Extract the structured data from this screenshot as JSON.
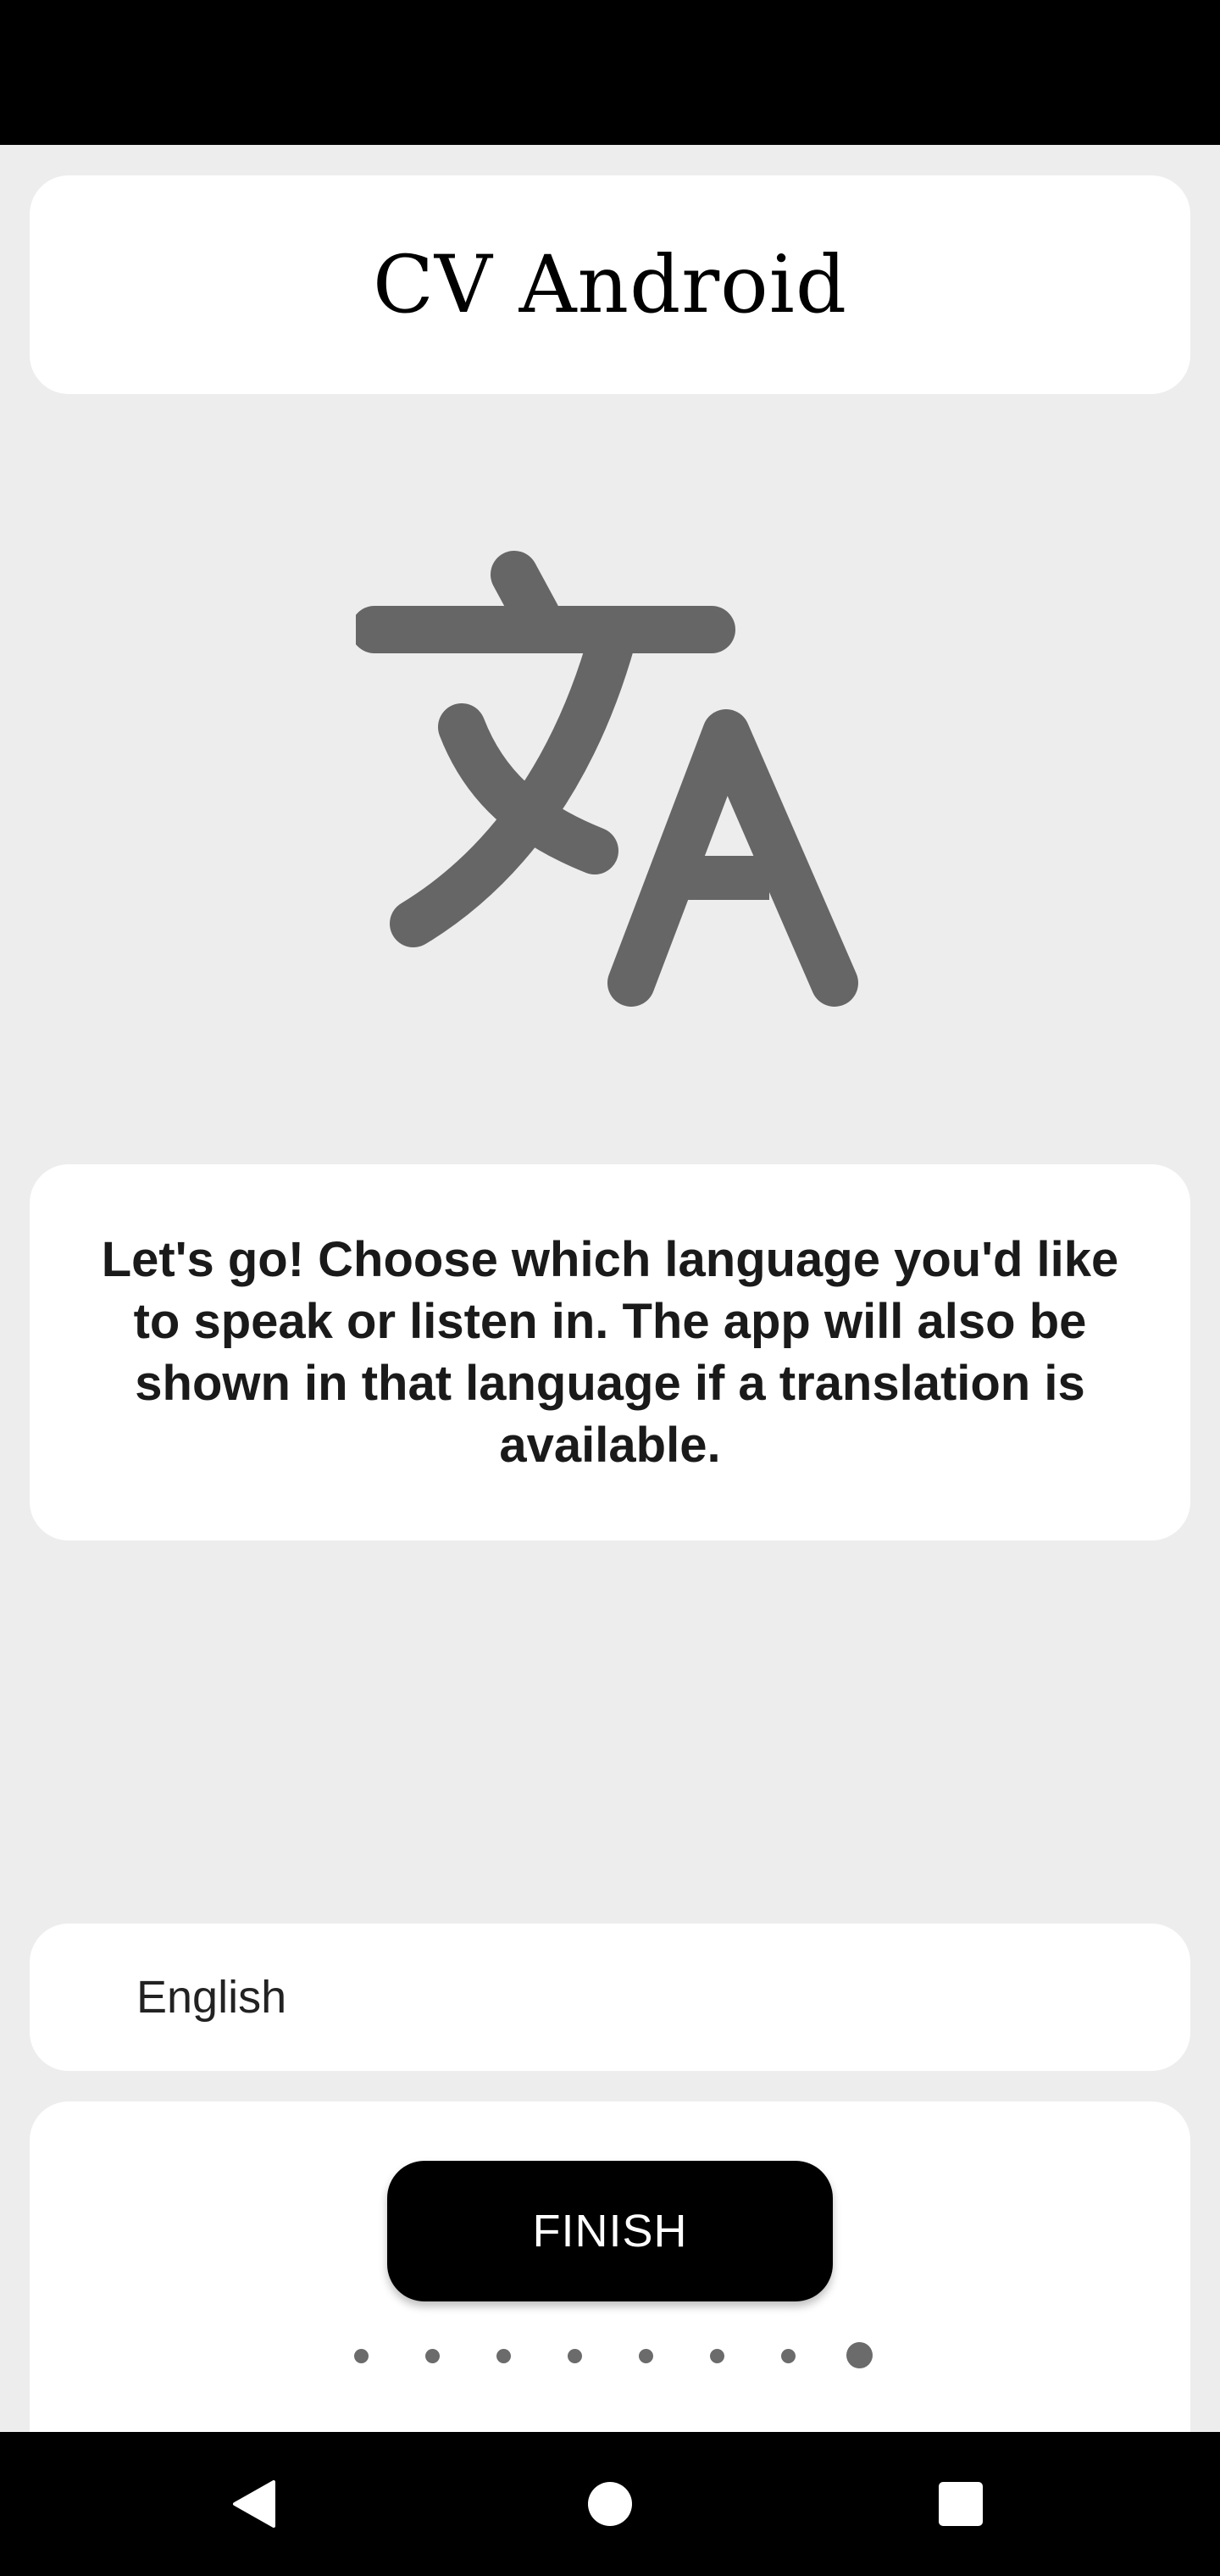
{
  "header": {
    "title": "CV Android"
  },
  "hero": {
    "icon": "translate-icon",
    "icon_color": "#666666"
  },
  "onboarding": {
    "message": "Let's go! Choose which language you'd like to speak or listen in. The app will also be shown in that language if a translation is available."
  },
  "language_selector": {
    "selected": "English"
  },
  "footer": {
    "finish_label": "FINISH",
    "pager": {
      "total": 8,
      "current": 8
    }
  },
  "system_nav": {
    "buttons": [
      "back-icon",
      "home-icon",
      "recents-icon"
    ]
  },
  "colors": {
    "background": "#ededed",
    "card": "#ffffff",
    "accent": "#000000",
    "dot": "#6b6b6b"
  }
}
